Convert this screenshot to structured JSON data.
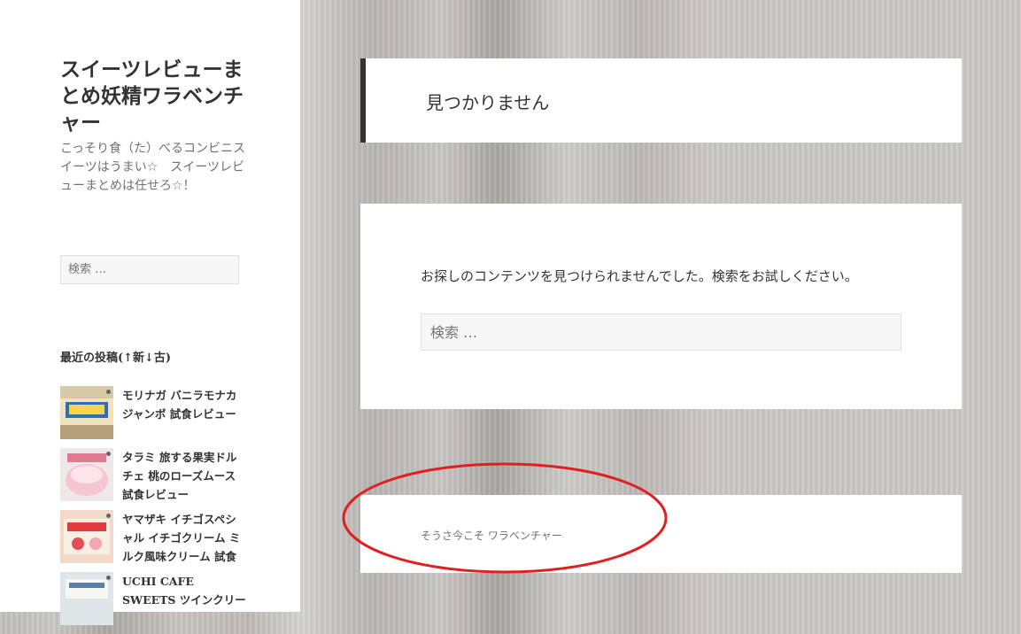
{
  "site": {
    "title": "スイーツレビューまとめ妖精ワラベンチャー",
    "description": "こっそり食（た）べるコンビニスイーツはうまい☆　スイーツレビューまとめは任せろ☆！"
  },
  "sidebar": {
    "search_placeholder": "検索 …",
    "recent_title": "最近の投稿(↑新↓古)",
    "posts": [
      {
        "title": "モリナガ バニラモナカジャンボ 試食レビュー",
        "thumb_icon": "ice-cream-package-thumbnail"
      },
      {
        "title": "タラミ 旅する果実ドルチェ 桃のローズムース 試食レビュー",
        "thumb_icon": "peach-dessert-cup-thumbnail"
      },
      {
        "title": "ヤマザキ イチゴスペシャル イチゴクリーム ミルク風味クリーム 試食レビュー",
        "thumb_icon": "strawberry-bread-package-thumbnail"
      },
      {
        "title": "UCHI CAFE SWEETS ツインクリー",
        "thumb_icon": "cream-sweets-package-thumbnail"
      }
    ]
  },
  "main": {
    "page_title": "見つかりません",
    "message": "お探しのコンテンツを見つけられませんでした。検索をお試しください。",
    "search_placeholder": "検索 …"
  },
  "footer": {
    "credit": "そうさ今こそ ワラベンチャー"
  },
  "colors": {
    "annotation": "#e02020",
    "card_border": "#333333"
  }
}
